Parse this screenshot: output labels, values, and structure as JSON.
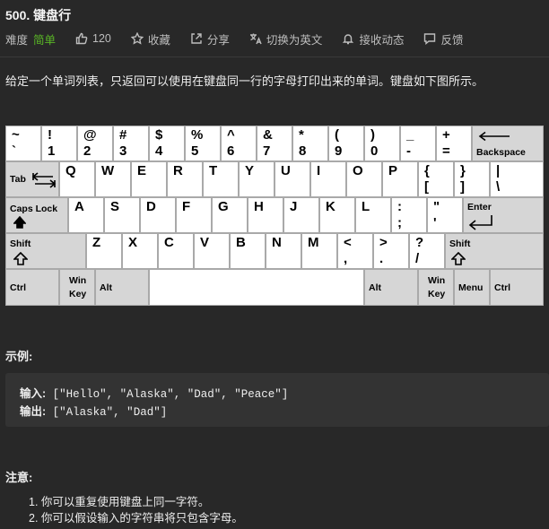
{
  "problem": {
    "title": "500. 键盘行",
    "difficulty_label": "难度",
    "difficulty": "简单",
    "likes": "120",
    "actions": {
      "favorite": "收藏",
      "share": "分享",
      "translate": "切换为英文",
      "notify": "接收动态",
      "feedback": "反馈"
    },
    "description": "给定一个单词列表，只返回可以使用在键盘同一行的字母打印出来的单词。键盘如下图所示。",
    "example_title": "示例:",
    "input_label": "输入:",
    "input_value": " [\"Hello\", \"Alaska\", \"Dad\", \"Peace\"]",
    "output_label": "输出:",
    "output_value": " [\"Alaska\", \"Dad\"]",
    "notes_title": "注意:",
    "notes": [
      "1. 你可以重复使用键盘上同一字符。",
      "2. 你可以假设输入的字符串将只包含字母。"
    ]
  },
  "keyboard": {
    "row1": [
      [
        "~",
        "`"
      ],
      [
        "!",
        "1"
      ],
      [
        "@",
        "2"
      ],
      [
        "#",
        "3"
      ],
      [
        "$",
        "4"
      ],
      [
        "%",
        "5"
      ],
      [
        "^",
        "6"
      ],
      [
        "&",
        "7"
      ],
      [
        "*",
        "8"
      ],
      [
        "(",
        "9"
      ],
      [
        ")",
        "0"
      ],
      [
        "_",
        "-"
      ],
      [
        "+",
        "="
      ]
    ],
    "backspace": "Backspace",
    "tab": "Tab",
    "row2": [
      "Q",
      "W",
      "E",
      "R",
      "T",
      "Y",
      "U",
      "I",
      "O",
      "P"
    ],
    "row2_symbols": [
      [
        "{",
        "["
      ],
      [
        "}",
        "]"
      ],
      [
        "|",
        "\\"
      ]
    ],
    "caps": "Caps Lock",
    "row3": [
      "A",
      "S",
      "D",
      "F",
      "G",
      "H",
      "J",
      "K",
      "L"
    ],
    "row3_symbols": [
      [
        ":",
        ";"
      ],
      [
        "\"",
        "'"
      ]
    ],
    "enter": "Enter",
    "shift": "Shift",
    "row4": [
      "Z",
      "X",
      "C",
      "V",
      "B",
      "N",
      "M"
    ],
    "row4_symbols": [
      [
        "<",
        ","
      ],
      [
        ">",
        "."
      ],
      [
        "?",
        "/"
      ]
    ],
    "ctrl": "Ctrl",
    "win": [
      "Win",
      "Key"
    ],
    "alt": "Alt",
    "menu": "Menu"
  }
}
